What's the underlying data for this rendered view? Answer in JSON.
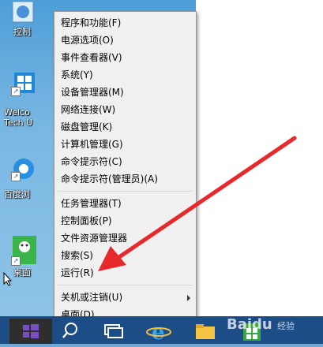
{
  "desktop": {
    "icons": [
      {
        "label": "控制",
        "icon": "control-panel-icon"
      },
      {
        "label": "Welco\nTech U",
        "icon": "welcome-windows-icon"
      },
      {
        "label": "百度浏",
        "icon": "baidu-browser-icon"
      },
      {
        "label": "桌面",
        "icon": "desktop-app-icon"
      }
    ]
  },
  "context_menu": {
    "items": [
      "程序和功能(F)",
      "电源选项(O)",
      "事件查看器(V)",
      "系统(Y)",
      "设备管理器(M)",
      "网络连接(W)",
      "磁盘管理(K)",
      "计算机管理(G)",
      "命令提示符(C)",
      "命令提示符(管理员)(A)",
      "任务管理器(T)",
      "控制面板(P)",
      "文件资源管理器",
      "搜索(S)",
      "运行(R)",
      "关机或注销(U)",
      "桌面(D)"
    ]
  },
  "taskbar": {
    "icons": [
      "windows-start-icon",
      "search-icon",
      "task-view-icon",
      "internet-explorer-icon",
      "file-explorer-icon",
      "store-icon"
    ]
  },
  "watermark": {
    "brand": "Baidu",
    "sub": "经验"
  },
  "colors": {
    "annotation_arrow": "#e8292b",
    "menu_bg": "#f0f0f0",
    "taskbar": "#1d4d87"
  }
}
